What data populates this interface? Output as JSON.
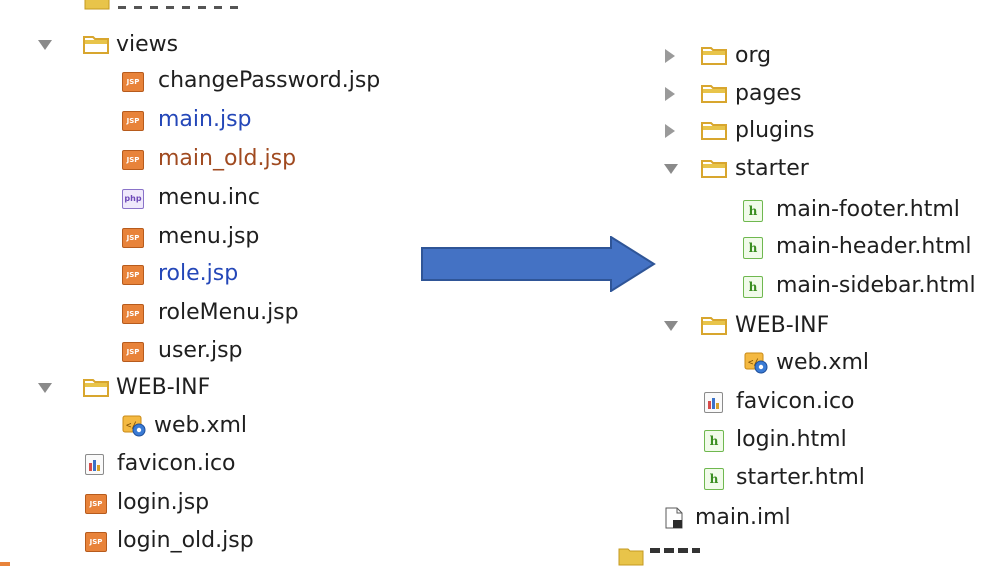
{
  "left_tree": {
    "views_label": "views",
    "files": [
      {
        "label": "changePassword.jsp",
        "icon": "jsp-file-icon",
        "color": "#1f1f1f"
      },
      {
        "label": "main.jsp",
        "icon": "jsp-file-icon",
        "color": "#2447b8"
      },
      {
        "label": "main_old.jsp",
        "icon": "jsp-file-icon",
        "color": "#a04a20"
      },
      {
        "label": "menu.inc",
        "icon": "php-file-icon",
        "color": "#1f1f1f"
      },
      {
        "label": "menu.jsp",
        "icon": "jsp-file-icon",
        "color": "#1f1f1f"
      },
      {
        "label": "role.jsp",
        "icon": "jsp-file-icon",
        "color": "#2447b8"
      },
      {
        "label": "roleMenu.jsp",
        "icon": "jsp-file-icon",
        "color": "#1f1f1f"
      },
      {
        "label": "user.jsp",
        "icon": "jsp-file-icon",
        "color": "#1f1f1f"
      }
    ],
    "webinf_label": "WEB-INF",
    "web_xml_label": "web.xml",
    "favicon_label": "favicon.ico",
    "login_label": "login.jsp",
    "login_old_label": "login_old.jsp"
  },
  "right_tree": {
    "org_label": "org",
    "pages_label": "pages",
    "plugins_label": "plugins",
    "starter_label": "starter",
    "starter_files": [
      {
        "label": "main-footer.html"
      },
      {
        "label": "main-header.html"
      },
      {
        "label": "main-sidebar.html"
      }
    ],
    "webinf_label": "WEB-INF",
    "web_xml_label": "web.xml",
    "favicon_label": "favicon.ico",
    "login_label": "login.html",
    "starter_html_label": "starter.html",
    "main_iml_label": "main.iml"
  },
  "icons": {
    "jsp_text": "JSP",
    "php_text": "php",
    "html_text": "h"
  },
  "colors": {
    "folder_fill": "#e8c44a",
    "arrow_fill": "#4472c4",
    "arrow_stroke": "#2f5597",
    "vcs_modified": "#2447b8",
    "vcs_unversioned": "#a04a20"
  }
}
